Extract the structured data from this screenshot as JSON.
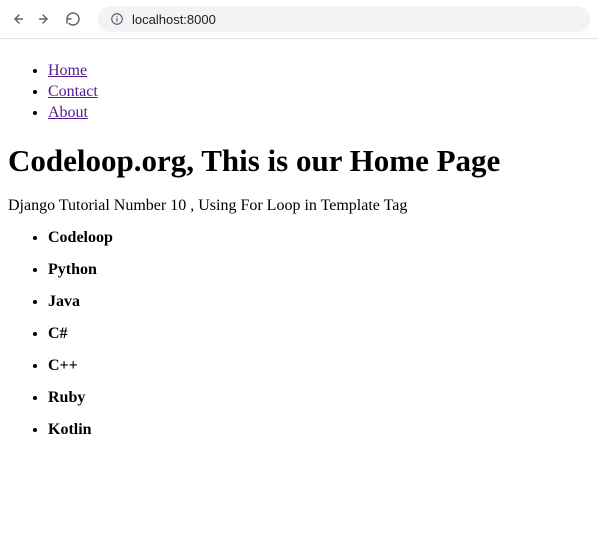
{
  "browser": {
    "url": "localhost:8000"
  },
  "nav": {
    "items": [
      {
        "label": "Home"
      },
      {
        "label": "Contact"
      },
      {
        "label": "About"
      }
    ]
  },
  "heading": "Codeloop.org, This is our Home Page",
  "description": "Django Tutorial Number 10 , Using For Loop in Template Tag",
  "items": [
    {
      "label": "Codeloop"
    },
    {
      "label": "Python"
    },
    {
      "label": "Java"
    },
    {
      "label": "C#"
    },
    {
      "label": "C++"
    },
    {
      "label": "Ruby"
    },
    {
      "label": "Kotlin"
    }
  ]
}
